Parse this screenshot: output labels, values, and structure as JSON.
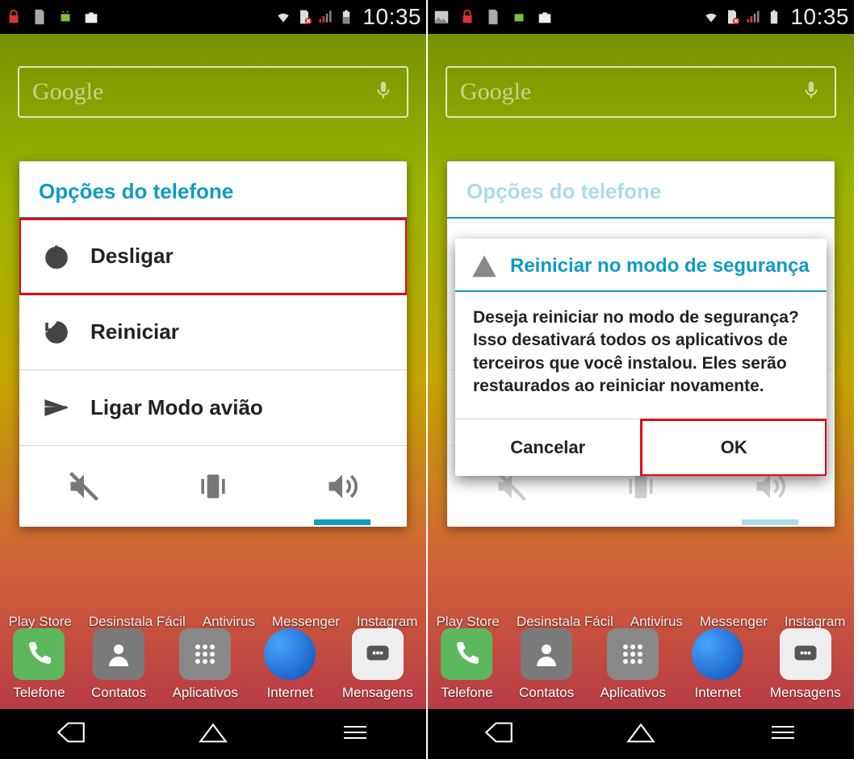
{
  "status": {
    "time": "10:35"
  },
  "search": {
    "brand": "Google"
  },
  "labels_row1": [
    "Play Store",
    "Desinstala Fácil",
    "Antivirus",
    "Messenger",
    "Instagram"
  ],
  "dock": [
    "Telefone",
    "Contatos",
    "Aplicativos",
    "Internet",
    "Mensagens"
  ],
  "phone_options": {
    "title": "Opções do telefone",
    "items": [
      {
        "label": "Desligar"
      },
      {
        "label": "Reiniciar"
      },
      {
        "label": "Ligar Modo avião"
      }
    ]
  },
  "dialog": {
    "title": "Reiniciar no modo de segurança",
    "body": "Deseja reiniciar no modo de segurança? Isso desativará todos os aplicativos de terceiros que você instalou. Eles serão restaurados ao reiniciar novamente.",
    "cancel": "Cancelar",
    "ok": "OK"
  }
}
